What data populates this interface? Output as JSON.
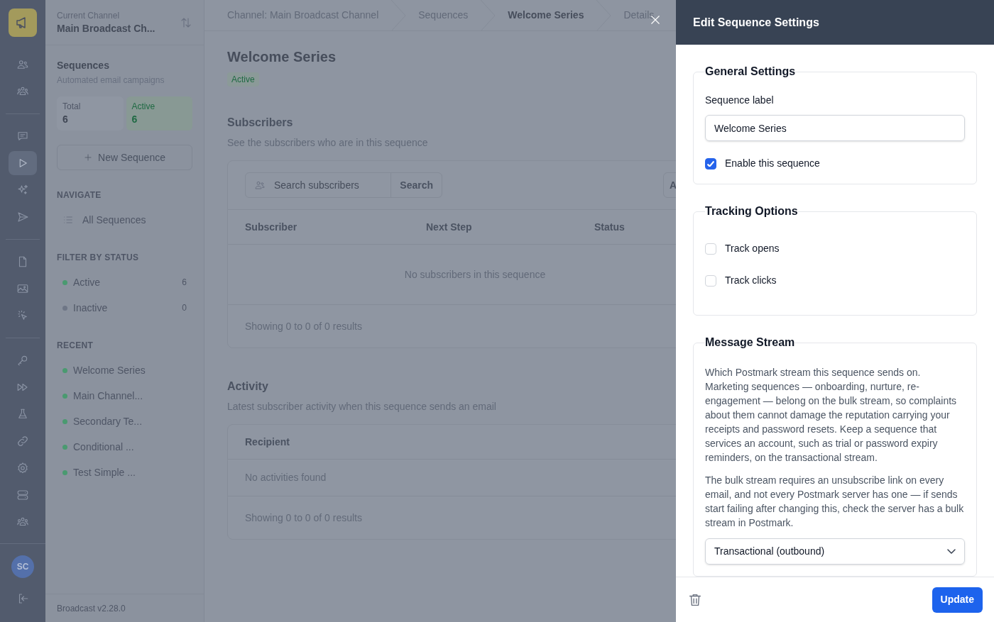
{
  "rail": [
    {
      "kind": "logo"
    },
    {
      "kind": "users",
      "selected": false
    },
    {
      "kind": "group",
      "selected": false
    },
    {
      "kind": "divider"
    },
    {
      "kind": "chat",
      "selected": false
    },
    {
      "kind": "play",
      "selected": true
    },
    {
      "kind": "sparkles",
      "selected": false
    },
    {
      "kind": "send",
      "selected": false
    },
    {
      "kind": "divider"
    },
    {
      "kind": "file",
      "selected": false
    },
    {
      "kind": "image",
      "selected": false
    },
    {
      "kind": "click",
      "selected": false
    },
    {
      "kind": "divider"
    },
    {
      "kind": "key",
      "selected": false
    },
    {
      "kind": "forward",
      "selected": false
    },
    {
      "kind": "flask",
      "selected": false
    },
    {
      "kind": "link",
      "selected": false
    },
    {
      "kind": "gear",
      "selected": false
    },
    {
      "kind": "server",
      "selected": false
    },
    {
      "kind": "group",
      "selected": false
    }
  ],
  "user": {
    "initials": "SC"
  },
  "sidebar": {
    "channel_label": "Current Channel",
    "channel_name": "Main Broadcast Ch...",
    "title": "Sequences",
    "subtitle": "Automated email campaigns",
    "stats": [
      {
        "label": "Total",
        "value": "6",
        "kind": "neutral"
      },
      {
        "label": "Active",
        "value": "6",
        "kind": "active"
      }
    ],
    "new_button": "New Sequence",
    "navigate_heading": "NAVIGATE",
    "navigate_items": [
      "All Sequences"
    ],
    "filter_heading": "FILTER BY STATUS",
    "filters": [
      {
        "label": "Active",
        "count": "6",
        "color": "#4a9a70"
      },
      {
        "label": "Inactive",
        "count": "0",
        "color": "#6e7686"
      }
    ],
    "recent_heading": "RECENT",
    "recent": [
      {
        "label": "Welcome Series",
        "color": "#4a9a70"
      },
      {
        "label": "Main Channel...",
        "color": "#4a9a70"
      },
      {
        "label": "Secondary Te...",
        "color": "#4a9a70"
      },
      {
        "label": "Conditional ...",
        "color": "#4a9a70"
      },
      {
        "label": "Test Simple ...",
        "color": "#4a9a70"
      }
    ],
    "version": "Broadcast v2.28.0"
  },
  "breadcrumbs": [
    {
      "label": "Channel: Main Broadcast Channel",
      "selected": false
    },
    {
      "label": "Sequences",
      "selected": false
    },
    {
      "label": "Welcome Series",
      "selected": true
    },
    {
      "label": "Details",
      "selected": false
    }
  ],
  "page": {
    "title": "Welcome Series",
    "status": "Active",
    "subscribers": {
      "title": "Subscribers",
      "description": "See the subscribers who are in this sequence",
      "search_placeholder": "Search subscribers",
      "search_button": "Search",
      "extra_button": "A",
      "columns": [
        "Subscriber",
        "Next Step",
        "Status"
      ],
      "empty": "No subscribers in this sequence",
      "footer": "Showing 0 to 0 of 0 results"
    },
    "activity": {
      "title": "Activity",
      "description": "Latest subscriber activity when this sequence sends an email",
      "columns": [
        "Recipient"
      ],
      "empty": "No activities found",
      "footer": "Showing 0 to 0 of 0 results"
    }
  },
  "panel": {
    "title": "Edit Sequence Settings",
    "general": {
      "legend": "General Settings",
      "label": "Sequence label",
      "value": "Welcome Series",
      "enable_label": "Enable this sequence",
      "enabled": true
    },
    "tracking": {
      "legend": "Tracking Options",
      "options": [
        {
          "label": "Track opens",
          "checked": false
        },
        {
          "label": "Track clicks",
          "checked": false
        }
      ]
    },
    "stream": {
      "legend": "Message Stream",
      "paragraphs": [
        "Which Postmark stream this sequence sends on. Marketing sequences — onboarding, nurture, re-engagement — belong on the bulk stream, so complaints about them cannot damage the reputation carrying your receipts and password resets. Keep a sequence that services an account, such as trial or password expiry reminders, on the transactional stream.",
        "The bulk stream requires an unsubscribe link on every email, and not every Postmark server has one — if sends start failing after changing this, check the server has a bulk stream in Postmark."
      ],
      "selected": "Transactional (outbound)"
    },
    "update_button": "Update"
  }
}
